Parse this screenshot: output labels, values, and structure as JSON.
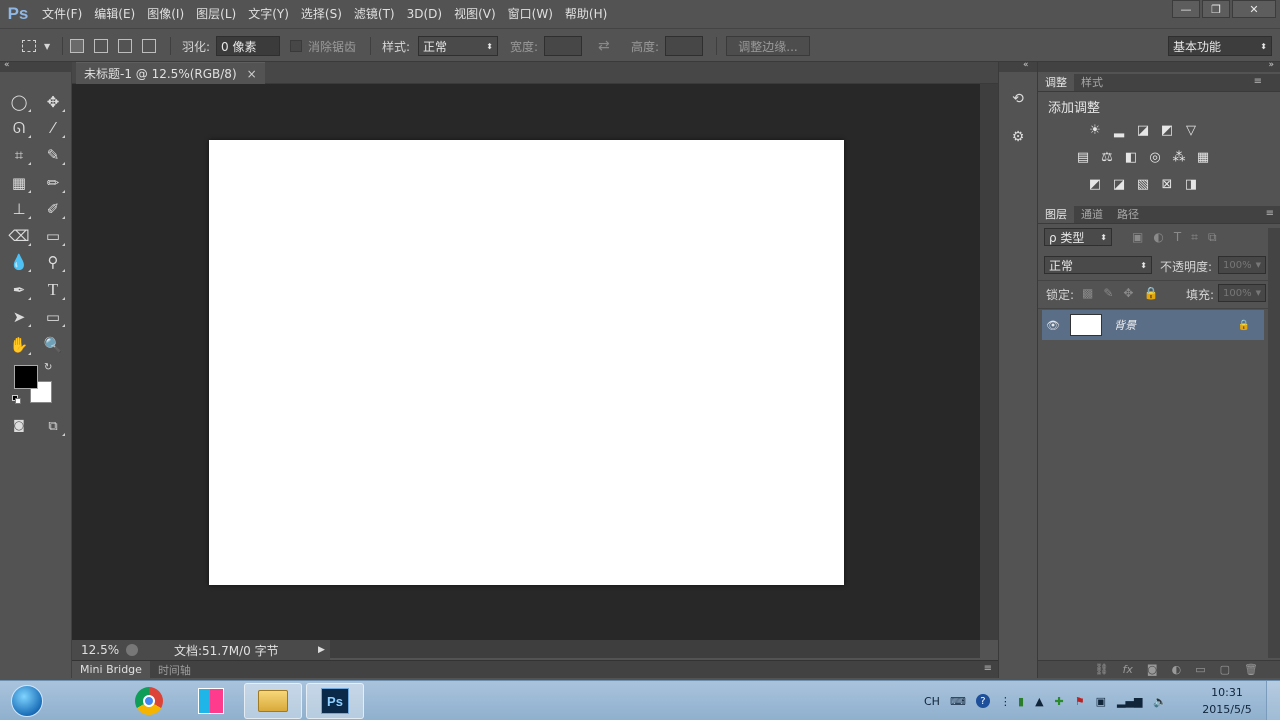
{
  "app": {
    "logo": "Ps",
    "menu": [
      "文件(F)",
      "编辑(E)",
      "图像(I)",
      "图层(L)",
      "文字(Y)",
      "选择(S)",
      "滤镜(T)",
      "3D(D)",
      "视图(V)",
      "窗口(W)",
      "帮助(H)"
    ],
    "window_controls": {
      "minimize": "—",
      "restore": "❐",
      "close": "✕"
    }
  },
  "options_bar": {
    "feather_label": "羽化:",
    "feather_value": "0 像素",
    "antialias_label": "消除锯齿",
    "style_label": "样式:",
    "style_value": "正常",
    "width_label": "宽度:",
    "swap_icon": "⇄",
    "height_label": "高度:",
    "refine_edge_label": "调整边缘...",
    "workspace_value": "基本功能"
  },
  "document": {
    "tab_title": "未标题-1 @ 12.5%(RGB/8)",
    "tab_close": "×",
    "zoom": "12.5%",
    "doc_info": "文档:51.7M/0 字节",
    "canvas_color": "#ffffff"
  },
  "bottom_tabs": [
    "Mini Bridge",
    "时间轴"
  ],
  "adjustments_panel": {
    "tabs": [
      "调整",
      "样式"
    ],
    "header": "添加调整"
  },
  "layers_panel": {
    "tabs": [
      "图层",
      "通道",
      "路径"
    ],
    "filter_label": "ρ 类型",
    "blend_mode": "正常",
    "opacity_label": "不透明度:",
    "opacity_value": "100%",
    "lock_label": "锁定:",
    "fill_label": "填充:",
    "fill_value": "100%",
    "layers": [
      {
        "name": "背景"
      }
    ]
  },
  "taskbar": {
    "lang": "CH",
    "time": "10:31",
    "date": "2015/5/5",
    "ps_label": "Ps"
  },
  "colors": {
    "ui_bg": "#535353",
    "canvas_bg": "#282828",
    "selected_layer": "#5a6e88",
    "foreground": "#000000",
    "background": "#ffffff"
  }
}
